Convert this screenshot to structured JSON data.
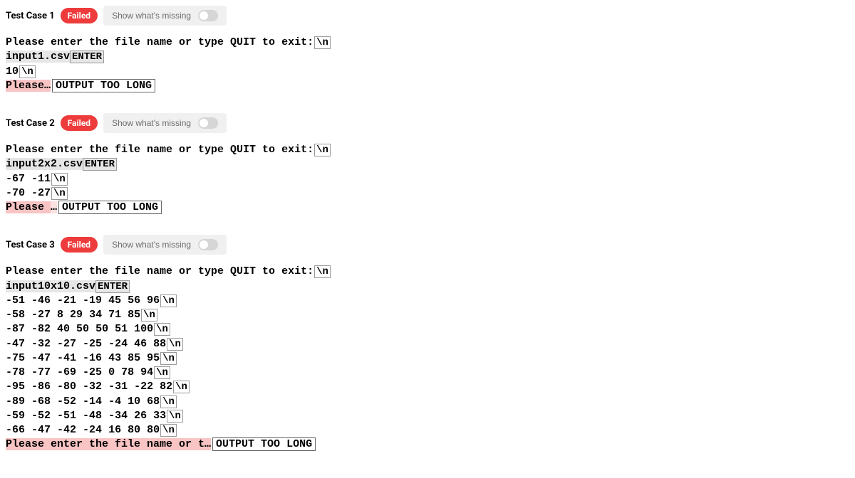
{
  "common": {
    "failed_label": "Failed",
    "show_missing_label": "Show what's missing",
    "nl_token": "\\n",
    "enter_token": "ENTER",
    "too_long": "OUTPUT TOO LONG",
    "prompt": "Please enter the file name or type QUIT to exit:"
  },
  "test1": {
    "title": "Test Case 1",
    "input_val": "input1.csv",
    "line3": "10",
    "line4_prefix": "Please…"
  },
  "test2": {
    "title": "Test Case 2",
    "input_val": "input2x2.csv",
    "r1_c1": "-67",
    "r1_c2": "-11",
    "r2_c1": "-70",
    "r2_c2": "-27",
    "end_prefix": "Please ",
    "end_ellipsis": "…"
  },
  "test3": {
    "title": "Test Case 3",
    "input_val": "input10x10.csv",
    "rows": {
      "r1": {
        "c1": "-51",
        "c2": "-46",
        "c3": "-21",
        "c4": "-19",
        "c5": "45",
        "c6": "56",
        "c7": "96"
      },
      "r2": {
        "c1": "-58",
        "c2": "-27",
        "c3": "8",
        "c4": "29",
        "c5": "34",
        "c6": "71",
        "c7": "85"
      },
      "r3": {
        "c1": "-87",
        "c2": "-82",
        "c3": "40",
        "c4": "50",
        "c5": "50",
        "c6": "51",
        "c7": "100"
      },
      "r4": {
        "c1": "-47",
        "c2": "-32",
        "c3": "-27",
        "c4": "-25",
        "c5": "-24",
        "c6": "46",
        "c7": "88"
      },
      "r5": {
        "c1": "-75",
        "c2": "-47",
        "c3": "-41",
        "c4": "-16",
        "c5": "43",
        "c6": "85",
        "c7": "95"
      },
      "r6": {
        "c1": "-78",
        "c2": "-77",
        "c3": "-69",
        "c4": "-25",
        "c5": "0",
        "c6": "78",
        "c7": "94"
      },
      "r7": {
        "c1": "-95",
        "c2": "-86",
        "c3": "-80",
        "c4": "-32",
        "c5": "-31",
        "c6": "-22",
        "c7": "82"
      },
      "r8": {
        "c1": "-89",
        "c2": "-68",
        "c3": "-52",
        "c4": "-14",
        "c5": "-4",
        "c6": "10",
        "c7": "68"
      },
      "r9": {
        "c1": "-59",
        "c2": "-52",
        "c3": "-51",
        "c4": "-48",
        "c5": "-34",
        "c6": "26",
        "c7": "33"
      },
      "r10": {
        "c1": "-66",
        "c2": "-47",
        "c3": "-42",
        "c4": "-24",
        "c5": "16",
        "c6": "80",
        "c7": "80"
      }
    },
    "end_prefix": "Please enter the file name or t…"
  },
  "chart_data": {
    "type": "table",
    "title": "Test Case 3 output matrix (highlighted diff)",
    "rows": [
      [
        -51,
        -46,
        -21,
        -19,
        45,
        56,
        96
      ],
      [
        -58,
        -27,
        8,
        29,
        34,
        71,
        85
      ],
      [
        -87,
        -82,
        40,
        50,
        50,
        51,
        100
      ],
      [
        -47,
        -32,
        -27,
        -25,
        -24,
        46,
        88
      ],
      [
        -75,
        -47,
        -41,
        -16,
        43,
        85,
        95
      ],
      [
        -78,
        -77,
        -69,
        -25,
        0,
        78,
        94
      ],
      [
        -95,
        -86,
        -80,
        -32,
        -31,
        -22,
        82
      ],
      [
        -89,
        -68,
        -52,
        -14,
        -4,
        10,
        68
      ],
      [
        -59,
        -52,
        -51,
        -48,
        -34,
        26,
        33
      ],
      [
        -66,
        -47,
        -42,
        -24,
        16,
        80,
        80
      ]
    ]
  }
}
